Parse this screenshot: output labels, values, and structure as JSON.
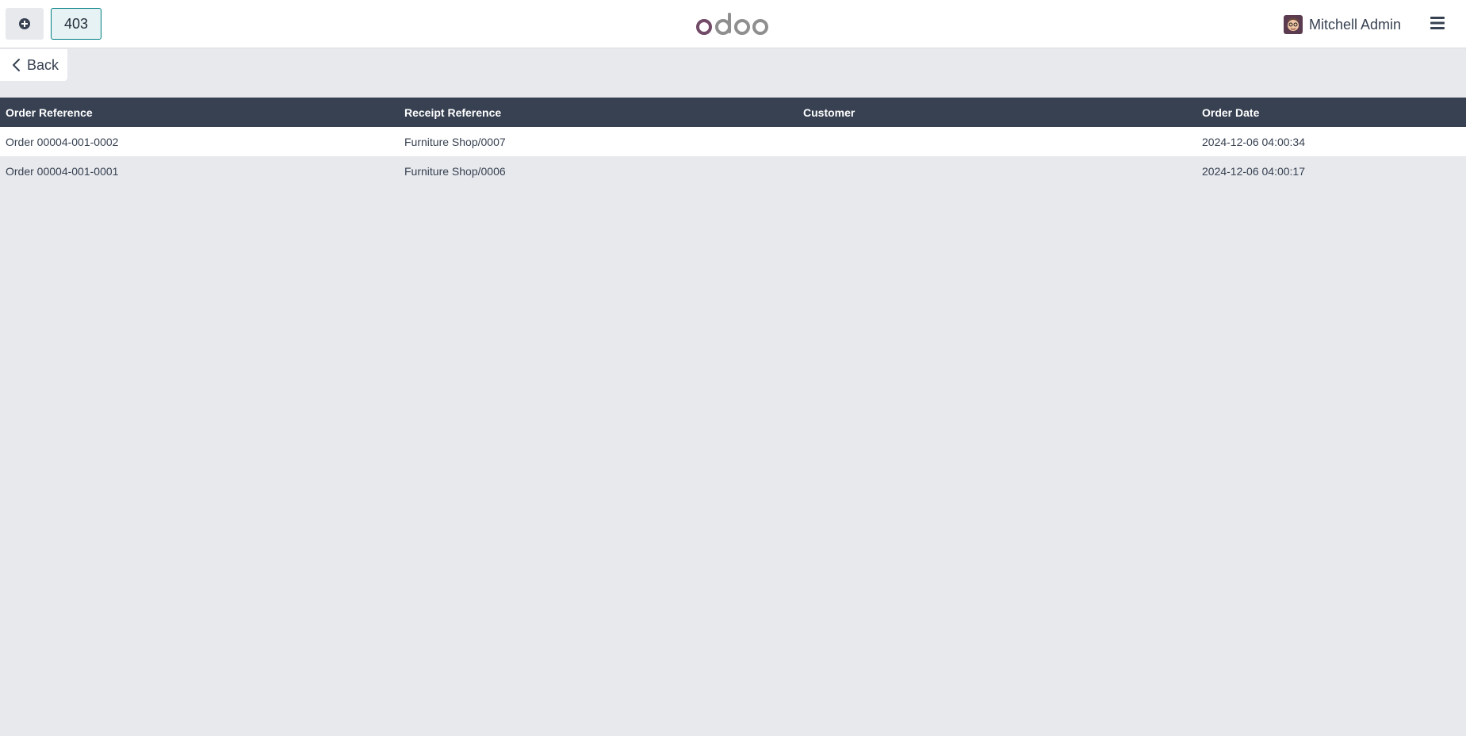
{
  "header": {
    "order_button_label": "403",
    "user_name": "Mitchell Admin",
    "icons": {
      "new_order": "plus-circle-icon",
      "menu": "hamburger-menu-icon",
      "logo": "odoo-logo"
    }
  },
  "back_button": {
    "label": "Back"
  },
  "table": {
    "columns": [
      "Order Reference",
      "Receipt Reference",
      "Customer",
      "Order Date"
    ],
    "rows": [
      {
        "order_ref": "Order 00004-001-0002",
        "receipt_ref": "Furniture Shop/0007",
        "customer": "",
        "order_date": "2024-12-06 04:00:34"
      },
      {
        "order_ref": "Order 00004-001-0001",
        "receipt_ref": "Furniture Shop/0006",
        "customer": "",
        "order_date": "2024-12-06 04:00:17"
      }
    ]
  },
  "colors": {
    "header_bg": "#374151",
    "page_bg": "#e7e9ed",
    "accent": "#017e84",
    "logo_primary": "#714b67",
    "logo_secondary": "#8f8f8f"
  }
}
